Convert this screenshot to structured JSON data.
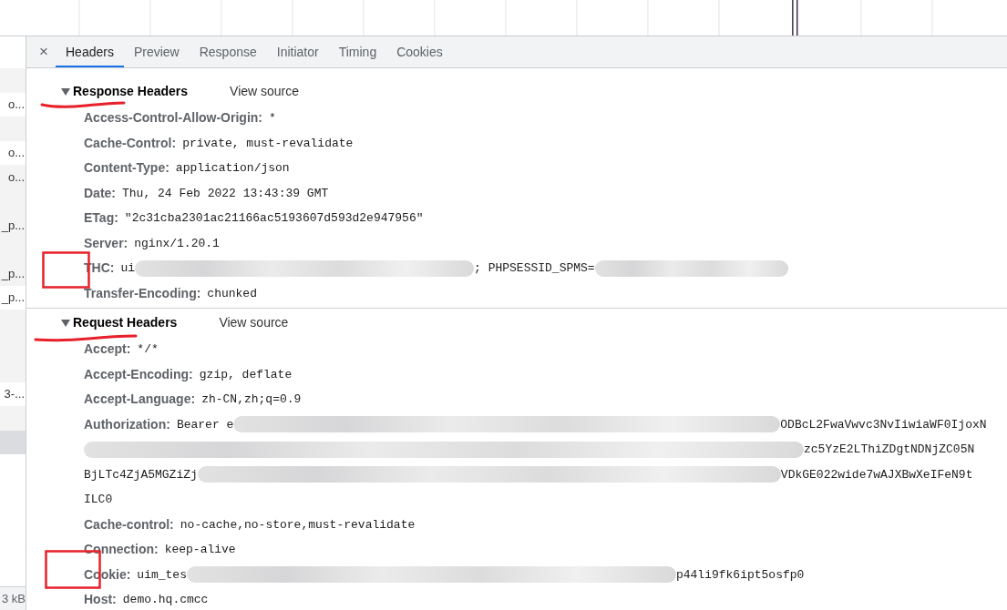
{
  "request_list": {
    "rows": [
      {
        "selected": false
      },
      {
        "text": "o...",
        "selected": false
      },
      {
        "selected": false
      },
      {
        "text": "o...",
        "selected": false
      },
      {
        "text": "o...",
        "selected": false
      },
      {
        "selected": false
      },
      {
        "text": "_p...",
        "selected": false
      },
      {
        "selected": false
      },
      {
        "text": "_p...",
        "selected": false
      },
      {
        "text": "_p...",
        "selected": false
      },
      {
        "selected": false
      },
      {
        "selected": false
      },
      {
        "selected": false
      },
      {
        "text": "3-...",
        "selected": false
      },
      {
        "selected": false
      },
      {
        "selected": true
      }
    ],
    "footer": "3 kB"
  },
  "tabs": {
    "close": "×",
    "items": [
      {
        "label": "Headers",
        "selected": true
      },
      {
        "label": "Preview",
        "selected": false
      },
      {
        "label": "Response",
        "selected": false
      },
      {
        "label": "Initiator",
        "selected": false
      },
      {
        "label": "Timing",
        "selected": false
      },
      {
        "label": "Cookies",
        "selected": false
      }
    ]
  },
  "sections": [
    {
      "title": "Response Headers",
      "expanded": true,
      "view_source": "View source",
      "headers": [
        {
          "name": "Access-Control-Allow-Origin:",
          "lines": [
            [
              {
                "kind": "text",
                "text": "*"
              }
            ]
          ]
        },
        {
          "name": "Cache-Control:",
          "lines": [
            [
              {
                "kind": "text",
                "text": "private, must-revalidate"
              }
            ]
          ]
        },
        {
          "name": "Content-Type:",
          "lines": [
            [
              {
                "kind": "text",
                "text": "application/json"
              }
            ]
          ]
        },
        {
          "name": "Date:",
          "lines": [
            [
              {
                "kind": "text",
                "text": "Thu, 24 Feb 2022 13:43:39 GMT"
              }
            ]
          ]
        },
        {
          "name": "ETag:",
          "lines": [
            [
              {
                "kind": "text",
                "text": "\"2c31cba2301ac21166ac5193607d593d2e947956\""
              }
            ]
          ]
        },
        {
          "name": "Server:",
          "lines": [
            [
              {
                "kind": "text",
                "text": "nginx/1.20.1"
              }
            ]
          ]
        },
        {
          "name": "THC:",
          "lines": [
            [
              {
                "kind": "text",
                "text": "ui"
              },
              {
                "kind": "redacted"
              },
              {
                "kind": "text",
                "text": "; PHPSESSID_SPMS="
              },
              {
                "kind": "redacted"
              }
            ]
          ]
        },
        {
          "name": "Transfer-Encoding:",
          "lines": [
            [
              {
                "kind": "text",
                "text": "chunked"
              }
            ]
          ]
        }
      ]
    },
    {
      "title": "Request Headers",
      "expanded": true,
      "view_source": "View source",
      "headers": [
        {
          "name": "Accept:",
          "lines": [
            [
              {
                "kind": "text",
                "text": "*/*"
              }
            ]
          ]
        },
        {
          "name": "Accept-Encoding:",
          "lines": [
            [
              {
                "kind": "text",
                "text": "gzip, deflate"
              }
            ]
          ]
        },
        {
          "name": "Accept-Language:",
          "lines": [
            [
              {
                "kind": "text",
                "text": "zh-CN,zh;q=0.9"
              }
            ]
          ]
        },
        {
          "name": "Authorization:",
          "lines": [
            [
              {
                "kind": "text",
                "text": "Bearer e"
              },
              {
                "kind": "redacted"
              },
              {
                "kind": "text",
                "text": "ODBcL2FwaVwvc3NvIiwiaWF0IjoxN"
              }
            ],
            [
              {
                "kind": "redacted"
              },
              {
                "kind": "text",
                "text": "zc5YzE2LThiZDgtNDNjZC05N"
              }
            ],
            [
              {
                "kind": "text",
                "text": "BjLTc4ZjA5MGZiZj"
              },
              {
                "kind": "redacted"
              },
              {
                "kind": "text",
                "text": "VDkGE022wide7wAJXBwXeIFeN9t"
              }
            ],
            [
              {
                "kind": "text",
                "text": "ILC0"
              }
            ]
          ]
        },
        {
          "name": "Cache-control:",
          "lines": [
            [
              {
                "kind": "text",
                "text": "no-cache,no-store,must-revalidate"
              }
            ]
          ]
        },
        {
          "name": "Connection:",
          "lines": [
            [
              {
                "kind": "text",
                "text": "keep-alive"
              }
            ]
          ]
        },
        {
          "name": "Cookie:",
          "lines": [
            [
              {
                "kind": "text",
                "text": "uim_tes"
              },
              {
                "kind": "redacted"
              },
              {
                "kind": "text",
                "text": "p44li9fk6ipt5osfp0"
              }
            ]
          ]
        },
        {
          "name": "Host:",
          "lines": [
            [
              {
                "kind": "text",
                "text": "demo.hq.cmcc"
              }
            ]
          ]
        }
      ]
    }
  ]
}
